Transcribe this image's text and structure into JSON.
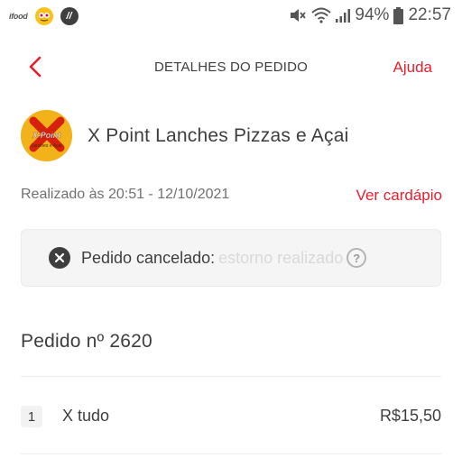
{
  "status_bar": {
    "app_badge": "ifood",
    "app2_label": "//",
    "battery_percent": "94%",
    "time": "22:57",
    "icons": [
      "mute-icon",
      "wifi-icon",
      "signal-icon",
      "battery-icon"
    ]
  },
  "header": {
    "title": "DETALHES DO PEDIDO",
    "help_label": "Ajuda",
    "back_icon": "chevron-left-icon"
  },
  "store": {
    "name": "X Point Lanches Pizzas e Açai",
    "logo_text": "X-Point",
    "logo_subtext": "Lanches e Açai"
  },
  "order_info": {
    "placed_text": "Realizado às 20:51 - 12/10/2021",
    "menu_link": "Ver cardápio"
  },
  "status": {
    "label": "Pedido cancelado:",
    "detail": "estorno realizado",
    "help_icon_text": "?"
  },
  "order": {
    "number_label": "Pedido nº 2620",
    "items": [
      {
        "qty": "1",
        "name": "X tudo",
        "price": "R$15,50"
      }
    ]
  },
  "colors": {
    "accent": "#ea1d2c",
    "text": "#3f3e3e",
    "muted": "#717171",
    "status_bg": "#f5f5f5",
    "logo_bg": "#f2b21a"
  }
}
